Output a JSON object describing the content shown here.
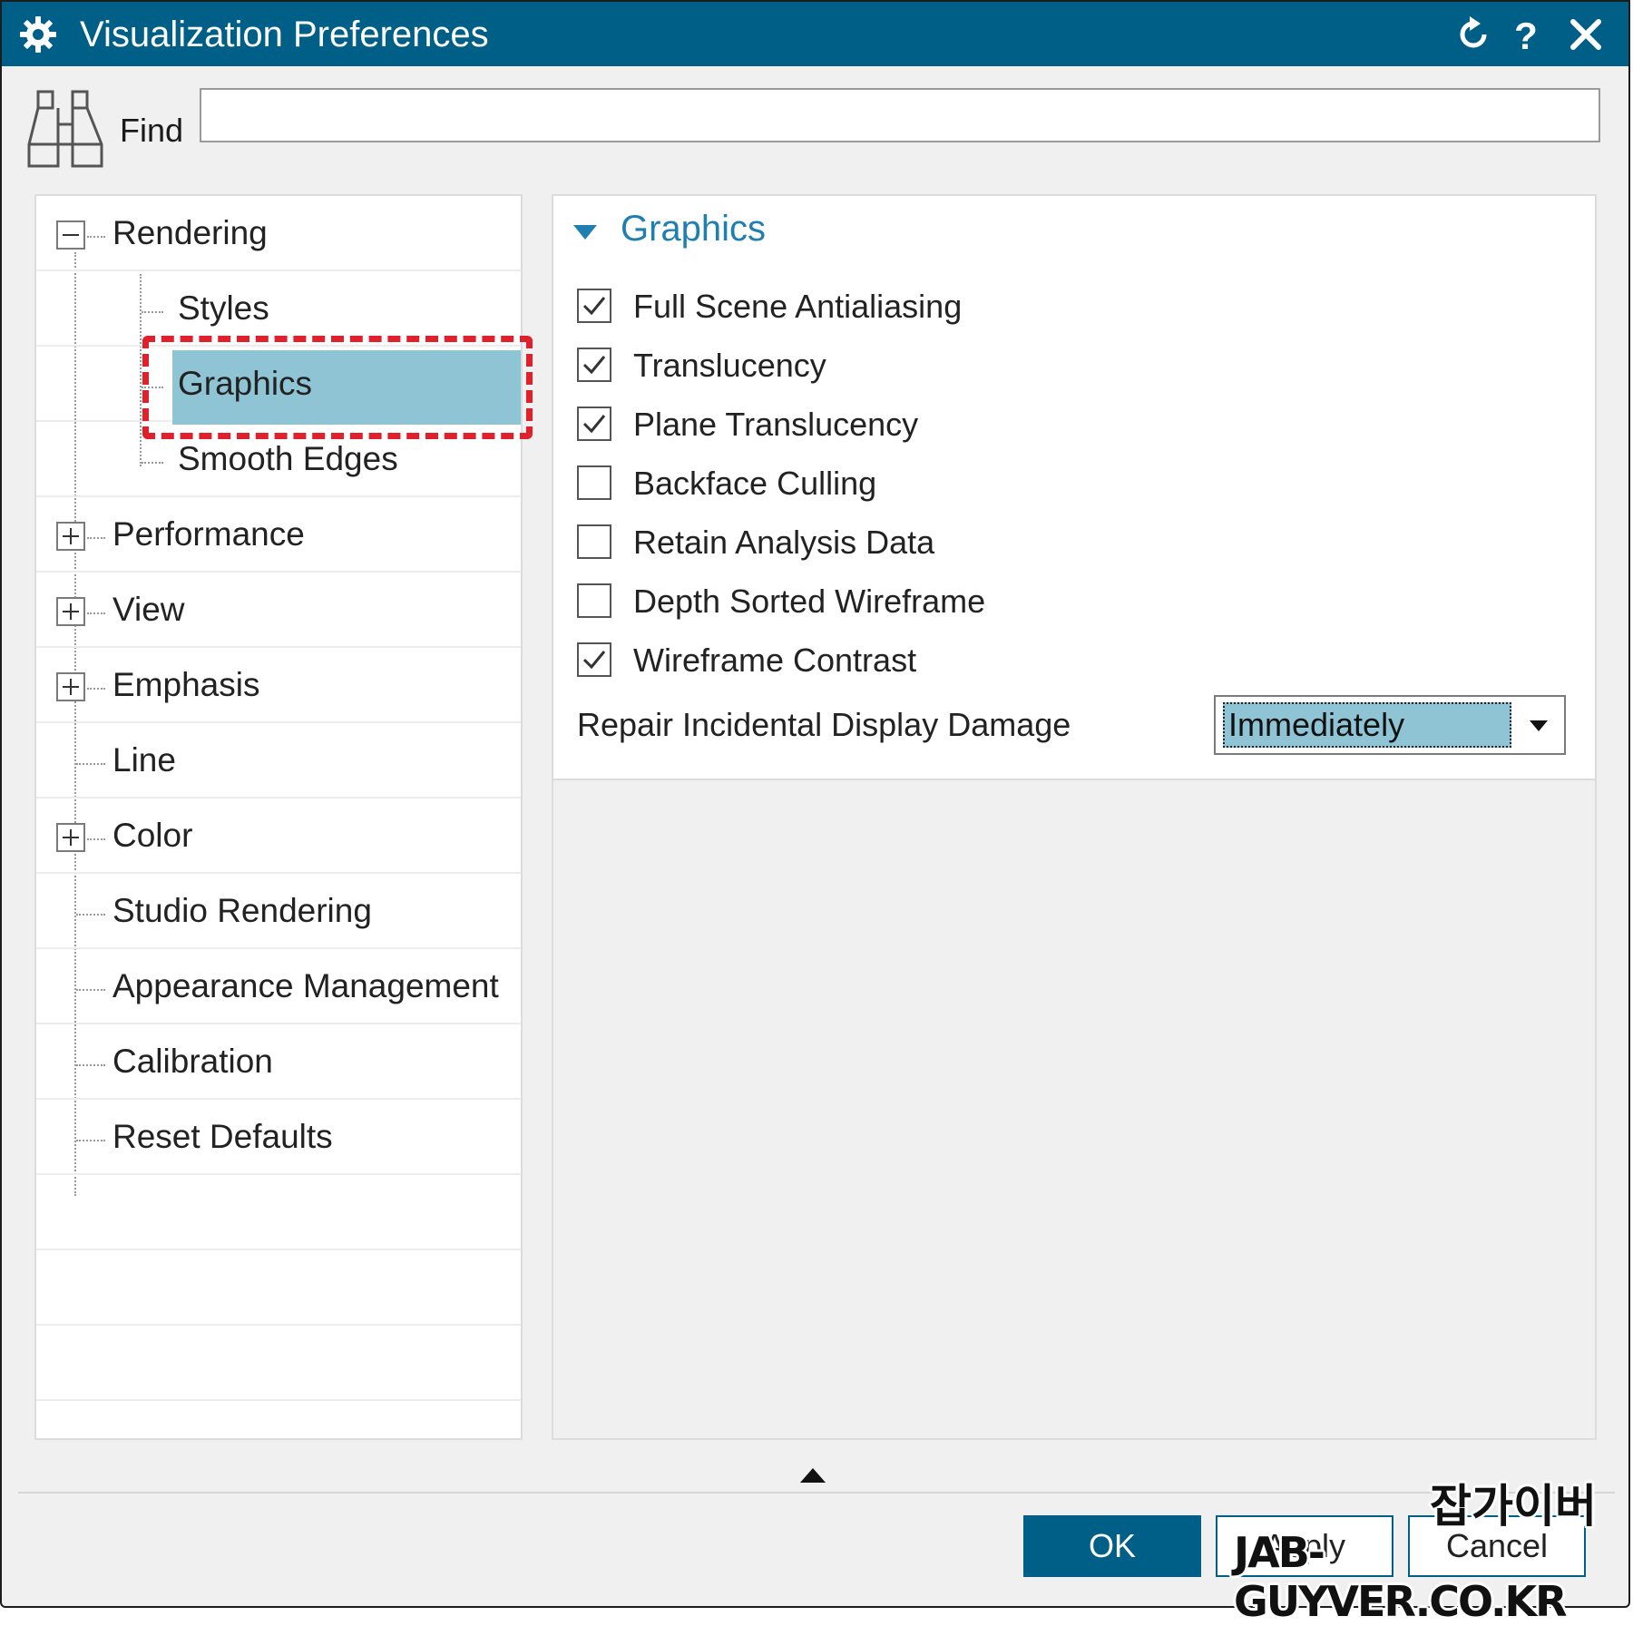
{
  "window": {
    "title": "Visualization Preferences",
    "title_icon": "gear-icon",
    "controls": [
      "reset-icon",
      "help-icon",
      "close-icon"
    ],
    "accent_color": "#005f86"
  },
  "find": {
    "label": "Find",
    "value": "",
    "icon": "binoculars-icon"
  },
  "tree": {
    "items": [
      {
        "label": "Rendering",
        "expander": "collapse"
      },
      {
        "label": "Styles"
      },
      {
        "label": "Graphics",
        "selected": true
      },
      {
        "label": "Smooth Edges"
      },
      {
        "label": "Performance",
        "expander": "expand"
      },
      {
        "label": "View",
        "expander": "expand"
      },
      {
        "label": "Emphasis",
        "expander": "expand"
      },
      {
        "label": "Line"
      },
      {
        "label": "Color",
        "expander": "expand"
      },
      {
        "label": "Studio Rendering"
      },
      {
        "label": "Appearance Management"
      },
      {
        "label": "Calibration"
      },
      {
        "label": "Reset Defaults"
      }
    ],
    "selection_color": "#8fc4d5",
    "highlight_color": "#e0202a"
  },
  "graphics": {
    "title": "Graphics",
    "title_color": "#1f7fb0",
    "options": [
      {
        "label": "Full Scene Antialiasing",
        "checked": true
      },
      {
        "label": "Translucency",
        "checked": true
      },
      {
        "label": "Plane Translucency",
        "checked": true
      },
      {
        "label": "Backface Culling",
        "checked": false
      },
      {
        "label": "Retain Analysis Data",
        "checked": false
      },
      {
        "label": "Depth Sorted Wireframe",
        "checked": false
      },
      {
        "label": "Wireframe Contrast",
        "checked": true
      }
    ],
    "repair_label": "Repair Incidental Display Damage",
    "repair_value": "Immediately"
  },
  "footer": {
    "ok_label": "OK",
    "apply_label": "Apply",
    "cancel_label": "Cancel"
  },
  "watermark": {
    "korean": "잡가이버",
    "site": "JAB-GUYVER.CO.KR"
  }
}
